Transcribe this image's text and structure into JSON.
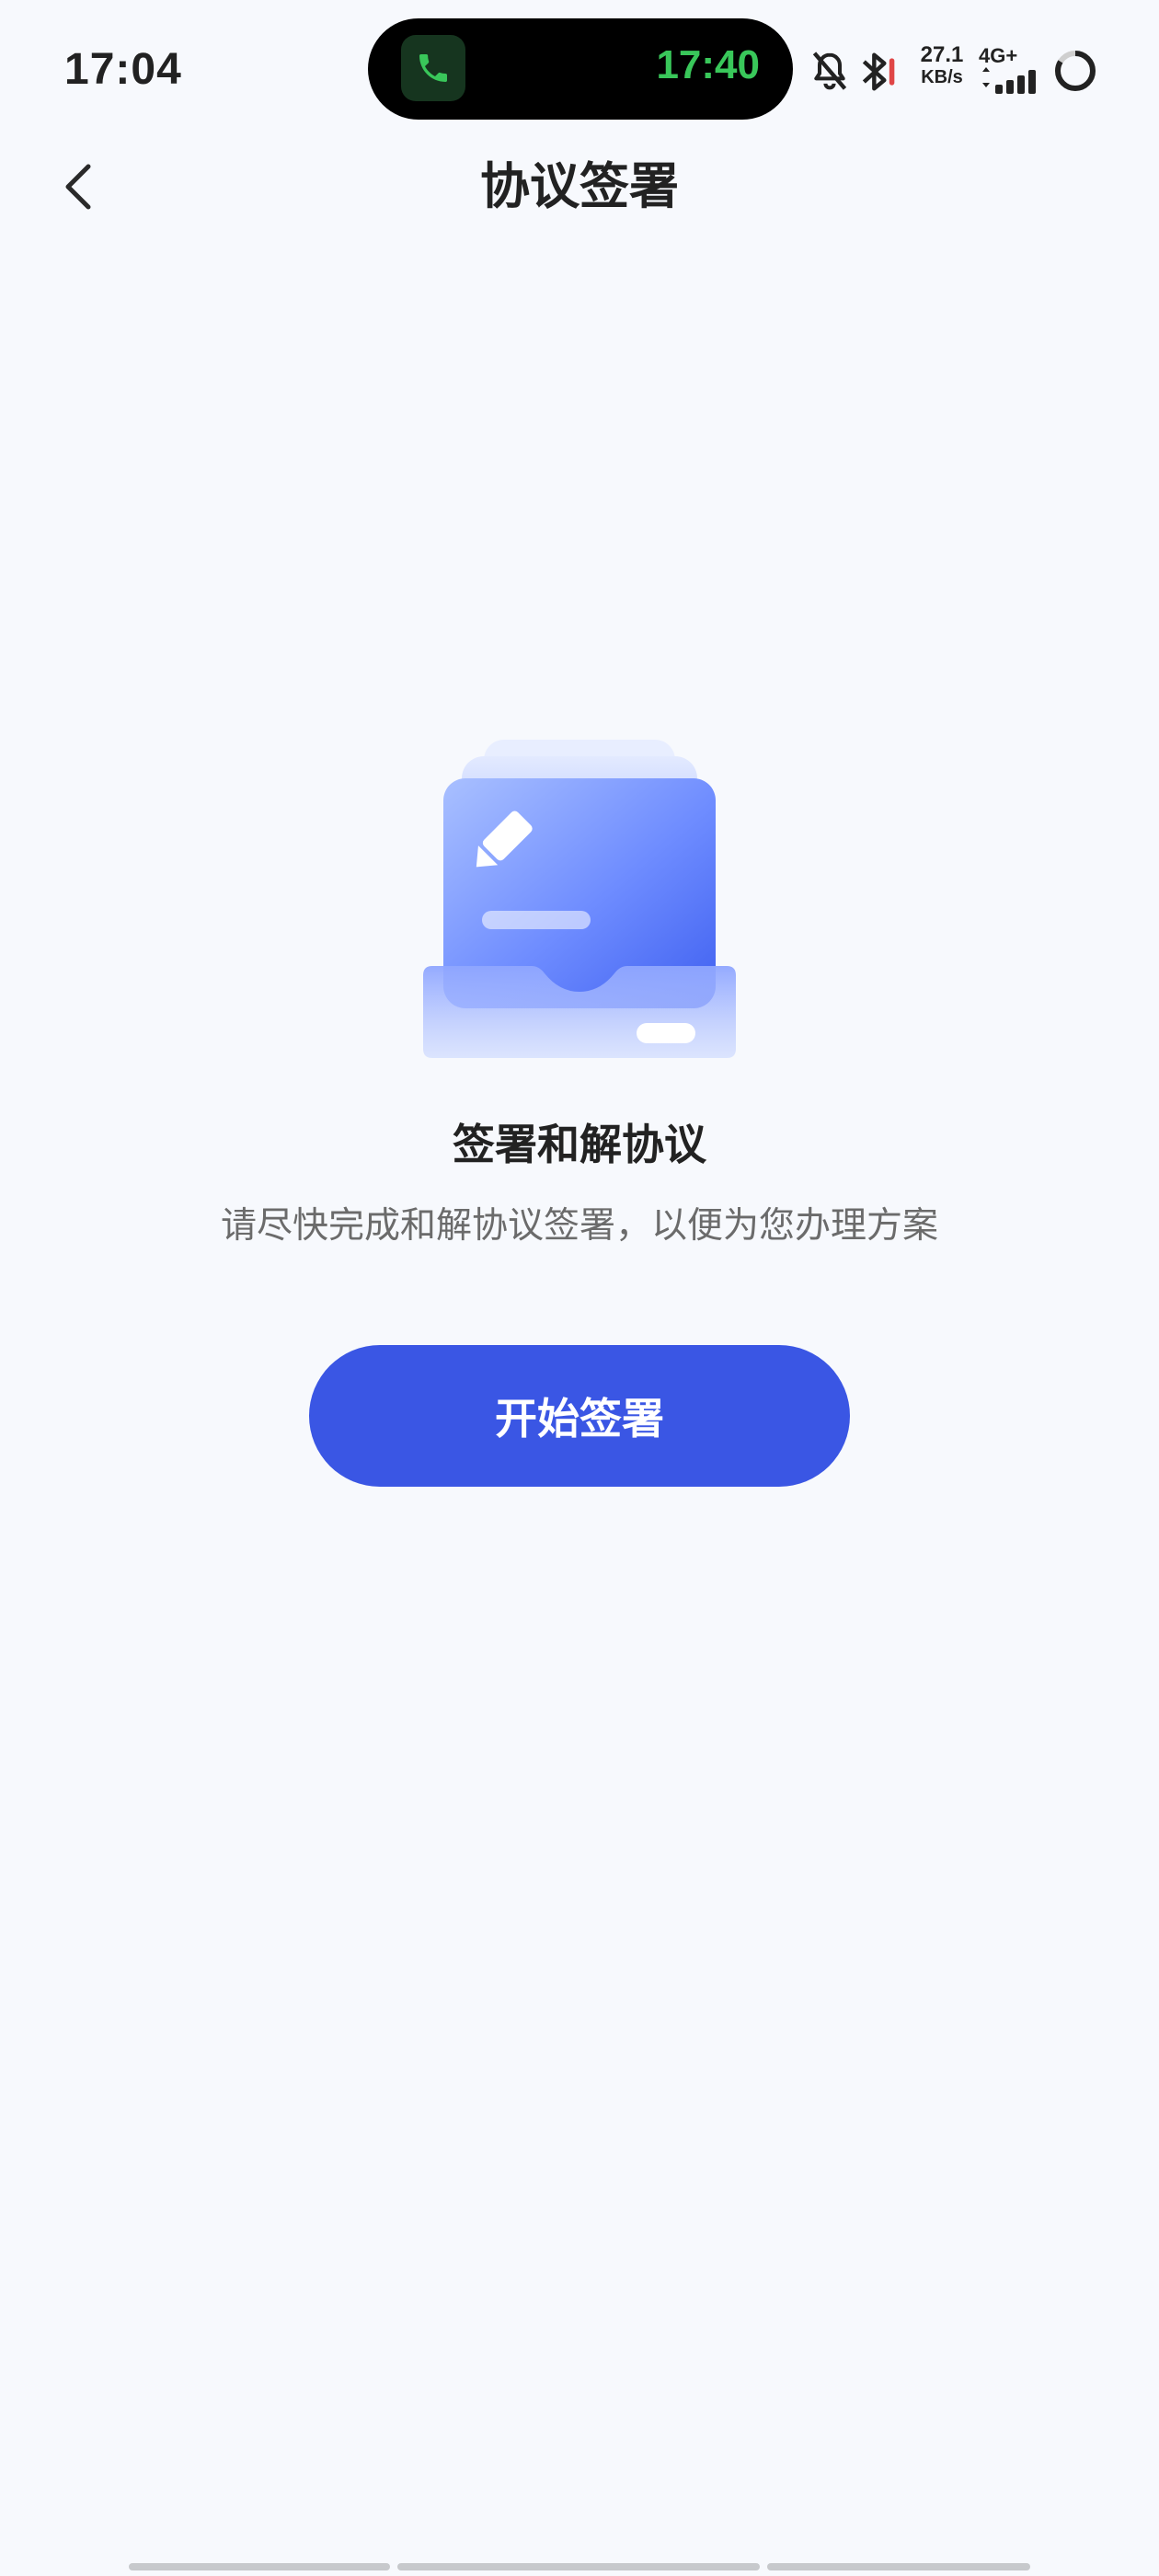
{
  "status_bar": {
    "time": "17:04",
    "call_time": "17:40",
    "net_speed_value": "27.1",
    "net_speed_unit": "KB/s",
    "network_type": "4G+"
  },
  "nav": {
    "title": "协议签署"
  },
  "content": {
    "headline": "签署和解协议",
    "description": "请尽快完成和解协议签署，以便为您办理方案",
    "button_label": "开始签署"
  },
  "colors": {
    "background": "#f7f9fd",
    "accent": "#3a56e4",
    "call_green": "#39c75a"
  }
}
